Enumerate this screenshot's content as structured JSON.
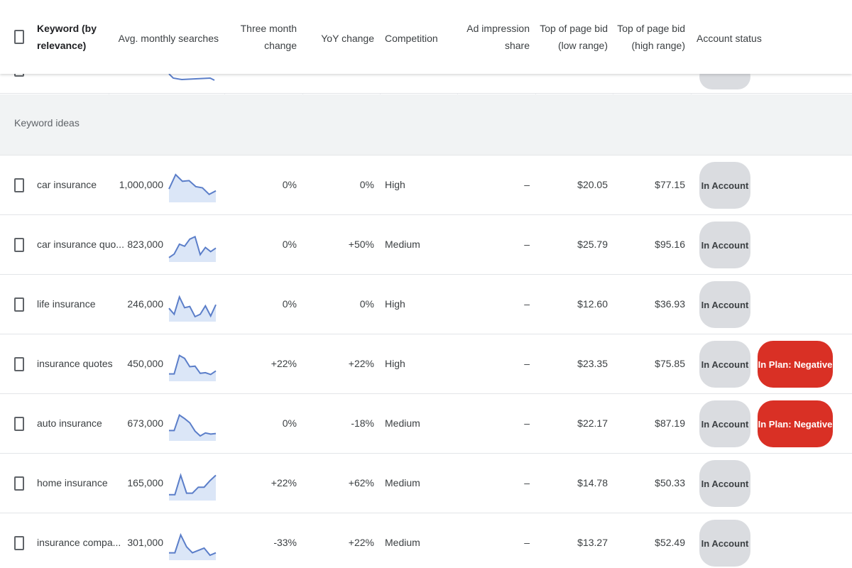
{
  "columns": {
    "keyword": "Keyword (by relevance)",
    "keyword_l1": "Keyword (by",
    "keyword_l2": "relevance)",
    "avg_searches": "Avg. monthly searches",
    "three_month_l1": "Three month",
    "three_month_l2": "change",
    "yoy": "YoY change",
    "competition": "Competition",
    "ad_share_l1": "Ad impression",
    "ad_share_l2": "share",
    "bid_low_l1": "Top of page bid",
    "bid_low_l2": "(low range)",
    "bid_high_l1": "Top of page bid",
    "bid_high_l2": "(high range)",
    "account_status": "Account status"
  },
  "section_label": "Keyword ideas",
  "colors": {
    "sparkline_stroke": "#5b7ec9",
    "sparkline_fill": "#dbe6f7",
    "negative_badge": "#d93025",
    "account_badge": "#dadce0"
  },
  "rows": [
    {
      "keyword": "car insurance",
      "searches": "1,000,000",
      "three_month": "0%",
      "yoy": "0%",
      "competition": "High",
      "ad_share": "–",
      "bid_low": "$20.05",
      "bid_high": "$77.15",
      "status": "In Account",
      "plan": "",
      "trend": [
        40,
        88,
        66,
        68,
        48,
        44,
        22,
        34
      ]
    },
    {
      "keyword": "car insurance quo...",
      "searches": "823,000",
      "three_month": "0%",
      "yoy": "+50%",
      "competition": "Medium",
      "ad_share": "–",
      "bid_low": "$25.79",
      "bid_high": "$95.16",
      "status": "In Account",
      "plan": "",
      "trend": [
        10,
        22,
        55,
        48,
        72,
        80,
        20,
        44,
        30,
        42
      ]
    },
    {
      "keyword": "life insurance",
      "searches": "246,000",
      "three_month": "0%",
      "yoy": "0%",
      "competition": "High",
      "ad_share": "–",
      "bid_low": "$12.60",
      "bid_high": "$36.93",
      "status": "In Account",
      "plan": "",
      "trend": [
        40,
        20,
        78,
        42,
        46,
        12,
        20,
        48,
        14,
        52
      ]
    },
    {
      "keyword": "insurance quotes",
      "searches": "450,000",
      "three_month": "+22%",
      "yoy": "+22%",
      "competition": "High",
      "ad_share": "–",
      "bid_low": "$23.35",
      "bid_high": "$75.85",
      "status": "In Account",
      "plan": "In Plan: Negative",
      "trend": [
        20,
        20,
        82,
        72,
        44,
        46,
        22,
        24,
        18,
        30
      ]
    },
    {
      "keyword": "auto insurance",
      "searches": "673,000",
      "three_month": "0%",
      "yoy": "-18%",
      "competition": "Medium",
      "ad_share": "–",
      "bid_low": "$22.17",
      "bid_high": "$87.19",
      "status": "In Account",
      "plan": "In Plan: Negative",
      "trend": [
        30,
        30,
        82,
        70,
        56,
        28,
        12,
        22,
        18,
        20
      ]
    },
    {
      "keyword": "home insurance",
      "searches": "165,000",
      "three_month": "+22%",
      "yoy": "+62%",
      "competition": "Medium",
      "ad_share": "–",
      "bid_low": "$14.78",
      "bid_high": "$50.33",
      "status": "In Account",
      "plan": "",
      "trend": [
        15,
        15,
        80,
        20,
        20,
        40,
        40,
        62,
        80
      ]
    },
    {
      "keyword": "insurance compa...",
      "searches": "301,000",
      "three_month": "-33%",
      "yoy": "+22%",
      "competition": "Medium",
      "ad_share": "–",
      "bid_low": "$13.27",
      "bid_high": "$52.49",
      "status": "In Account",
      "plan": "",
      "trend": [
        20,
        20,
        80,
        40,
        20,
        28,
        36,
        12,
        20
      ]
    }
  ]
}
